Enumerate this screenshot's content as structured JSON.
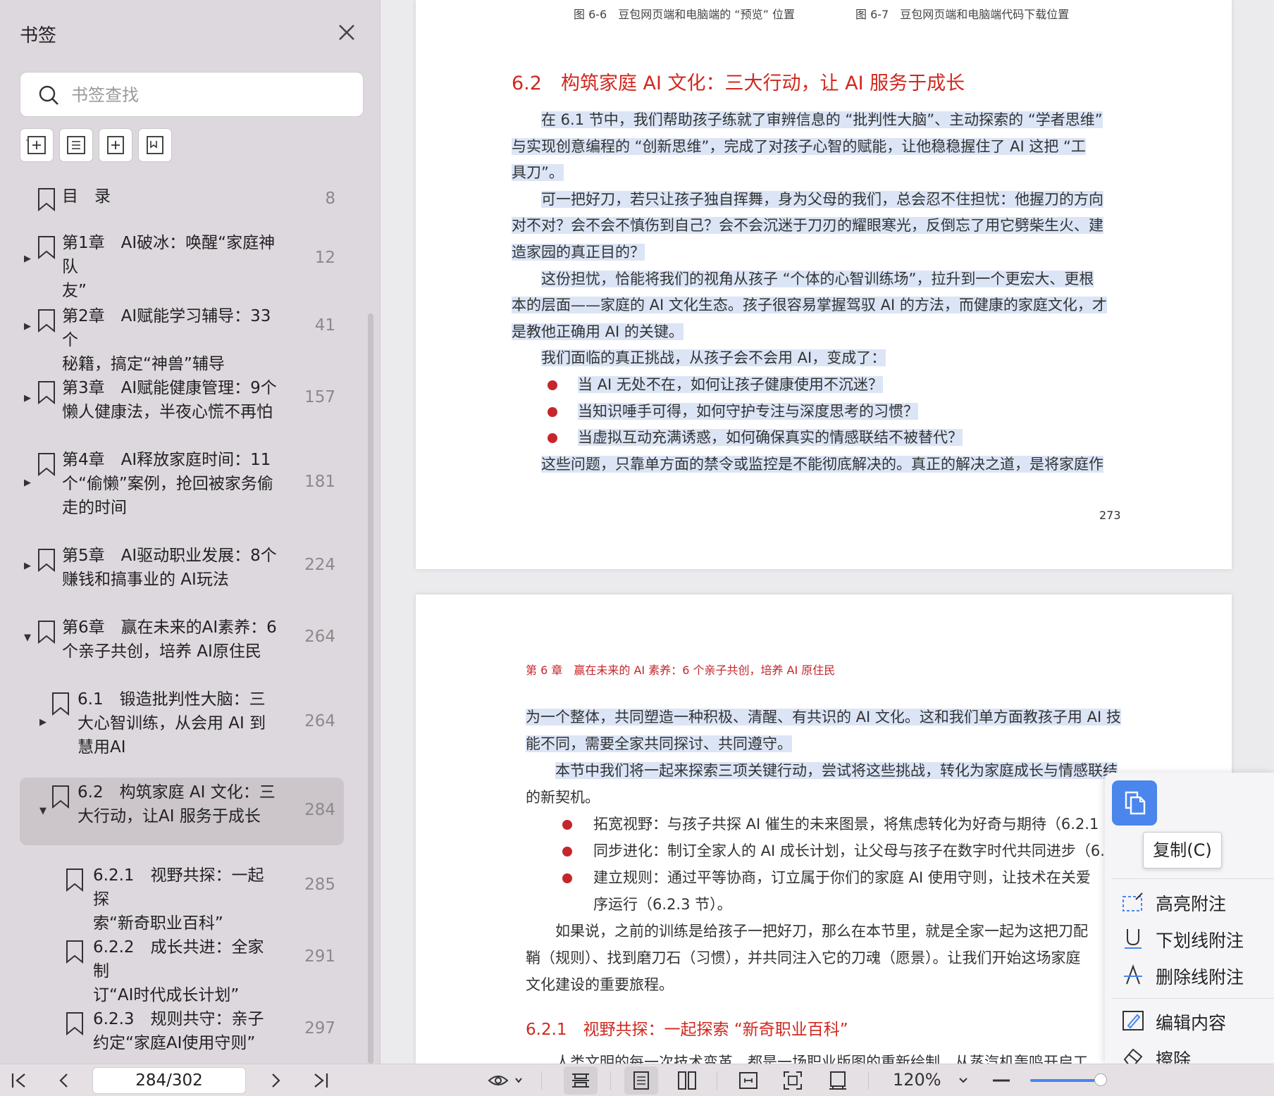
{
  "sidebar": {
    "title": "书签",
    "search_placeholder": "书签查找",
    "tools": [
      "add-bookmark-icon",
      "remove-bookmark-icon",
      "expand-bookmark-icon",
      "bookmark-icon"
    ],
    "items": [
      {
        "level": 0,
        "lines": [
          "目　录"
        ],
        "page": "8",
        "arrow": "",
        "selected": false
      },
      {
        "level": 0,
        "lines": [
          "第1章　AI破冰：唤醒“家庭神队",
          "友”"
        ],
        "page": "12",
        "arrow": "▶",
        "selected": false
      },
      {
        "level": 0,
        "lines": [
          "第2章　AI赋能学习辅导：33个",
          "秘籍，搞定“神兽”辅导"
        ],
        "page": "41",
        "arrow": "▶",
        "selected": false
      },
      {
        "level": 0,
        "lines": [
          "第3章　AI赋能健康管理：9个",
          "懒人健康法，半夜心慌不再怕"
        ],
        "page": "157",
        "arrow": "▶",
        "selected": false
      },
      {
        "level": 0,
        "lines": [
          "第4章　AI释放家庭时间：11",
          "个“偷懒”案例，抢回被家务偷",
          "走的时间"
        ],
        "page": "181",
        "arrow": "▶",
        "selected": false
      },
      {
        "level": 0,
        "lines": [
          "第5章　AI驱动职业发展：8个",
          "赚钱和搞事业的 AI玩法"
        ],
        "page": "224",
        "arrow": "▶",
        "selected": false
      },
      {
        "level": 0,
        "lines": [
          "第6章　赢在未来的AI素养：6",
          "个亲子共创，培养 AI原住民"
        ],
        "page": "264",
        "arrow": "▼",
        "selected": false
      },
      {
        "level": 1,
        "lines": [
          "6.1　锻造批判性大脑：三",
          "大心智训练，从会用 AI 到",
          "慧用AI"
        ],
        "page": "264",
        "arrow": "▶",
        "selected": false
      },
      {
        "level": 1,
        "lines": [
          "6.2　构筑家庭 AI 文化：三",
          "大行动，让AI 服务于成长"
        ],
        "page": "284",
        "arrow": "▼",
        "selected": true
      },
      {
        "level": 2,
        "lines": [
          "6.2.1　视野共探：一起探",
          "索“新奇职业百科”"
        ],
        "page": "285",
        "arrow": "",
        "selected": false
      },
      {
        "level": 2,
        "lines": [
          "6.2.2　成长共进：全家制",
          "订“AI时代成长计划”"
        ],
        "page": "291",
        "arrow": "",
        "selected": false
      },
      {
        "level": 2,
        "lines": [
          "6.2.3　规则共守：亲子",
          "约定“家庭AI使用守则”"
        ],
        "page": "297",
        "arrow": "",
        "selected": false
      }
    ]
  },
  "page1": {
    "captions": [
      "图 6-6　豆包网页端和电脑端的 “预览” 位置",
      "图 6-7　豆包网页端和电脑端代码下载位置"
    ],
    "heading": "6.2　构筑家庭 AI 文化：三大行动，让 AI 服务于成长",
    "lines": [
      "在 6.1 节中，我们帮助孩子练就了审辨信息的 “批判性大脑”、主动探索的 “学者思维”",
      "与实现创意编程的 “创新思维”，完成了对孩子心智的赋能，让他稳稳握住了 AI 这把 “工",
      "具刀”。",
      "可一把好刀，若只让孩子独自挥舞，身为父母的我们，总会忍不住担忧：他握刀的方向",
      "对不对？会不会不慎伤到自己？会不会沉迷于刀刃的耀眼寒光，反倒忘了用它劈柴生火、建",
      "造家园的真正目的？",
      "这份担忧，恰能将我们的视角从孩子 “个体的心智训练场”，拉升到一个更宏大、更根",
      "本的层面——家庭的 AI 文化生态。孩子很容易掌握驾驭 AI 的方法，而健康的家庭文化，才",
      "是教他正确用 AI 的关键。",
      "我们面临的真正挑战，从孩子会不会用 AI，变成了：",
      "当 AI 无处不在，如何让孩子健康使用不沉迷？",
      "当知识唾手可得，如何守护专注与深度思考的习惯？",
      "当虚拟互动充满诱惑，如何确保真实的情感联结不被替代？",
      "这些问题，只靠单方面的禁令或监控是不能彻底解决的。真正的解决之道，是将家庭作"
    ],
    "page_number": "273"
  },
  "page2": {
    "running_head": "第 6 章　赢在未来的 AI 素养：6 个亲子共创，培养 AI 原住民",
    "lines": [
      "为一个整体，共同塑造一种积极、清醒、有共识的 AI 文化。这和我们单方面教孩子用 AI 技",
      "能不同，需要全家共同探讨、共同遵守。",
      "本节中我们将一起来探索三项关键行动，尝试将这些挑战，转化为家庭成长与情感联结",
      "的新契机。",
      "拓宽视野：与孩子共探 AI 催生的未来图景，将焦虑转化为好奇与期待（6.2.1",
      "同步进化：制订全家人的 AI 成长计划，让父母与孩子在数字时代共同进步（6.2.2",
      "建立规则：通过平等协商，订立属于你们的家庭 AI 使用守则，让技术在关爱",
      "序运行（6.2.3 节）。",
      "如果说，之前的训练是给孩子一把好刀，那么在本节里，就是全家一起为这把刀配",
      "鞘（规则）、找到磨刀石（习惯），并共同注入它的刀魂（愿景）。让我们开始这场家庭",
      "文化建设的重要旅程。",
      "人类文明的每一次技术变革，都是一场职业版图的重新绘制。从蒸汽机轰鸣开启工"
    ],
    "subheading": "6.2.1　视野共探：一起探索 “新奇职业百科”"
  },
  "context_menu": {
    "copy_tooltip": "复制(C)",
    "items": [
      "高亮附注",
      "下划线附注",
      "删除线附注",
      "编辑内容",
      "擦除"
    ]
  },
  "bottom": {
    "page_indicator": "284/302",
    "zoom": "120%"
  },
  "colors": {
    "accent": "#4a86ec",
    "heading_red": "#d0281f",
    "selection": "#dbe5f6",
    "bullet": "#c5262c"
  }
}
